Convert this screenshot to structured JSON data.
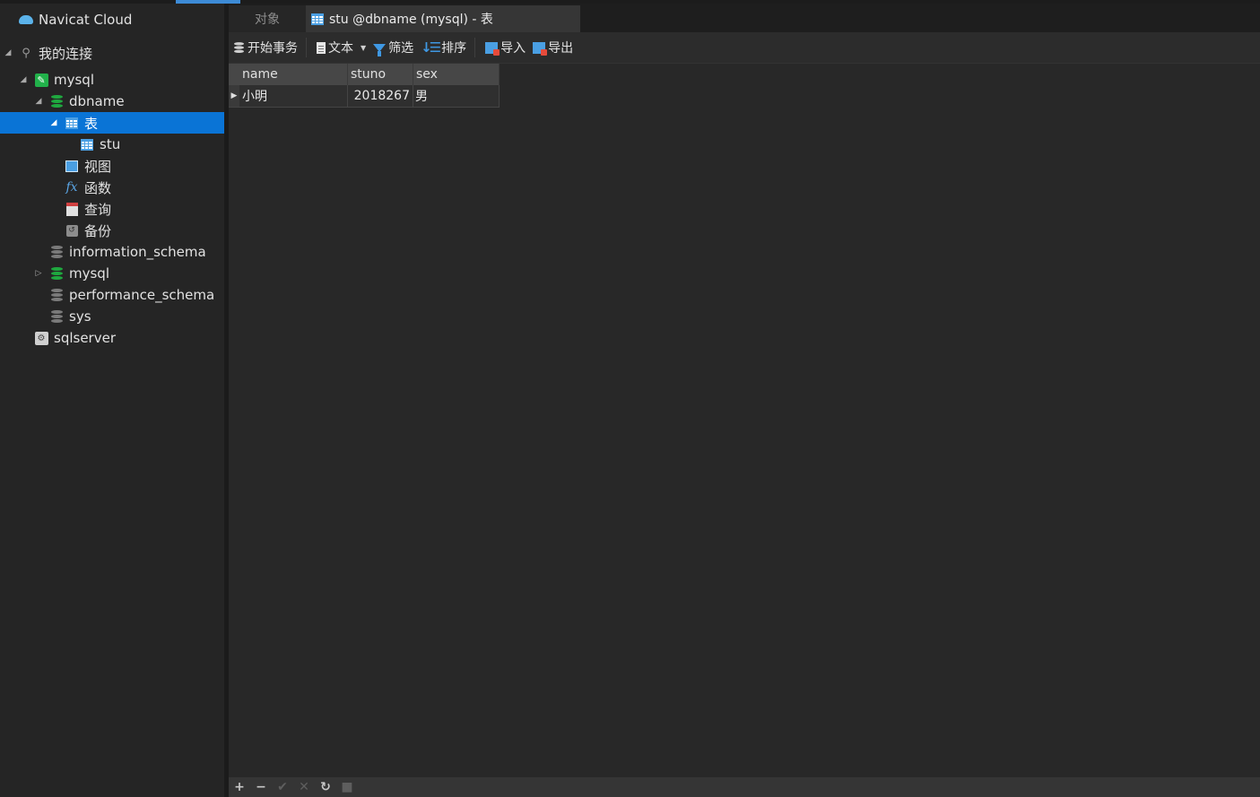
{
  "sidebar": {
    "cloud_label": "Navicat Cloud",
    "my_connections": "我的连接",
    "tree": {
      "mysql_conn": "mysql",
      "dbname": "dbname",
      "tables": "表",
      "table_stu": "stu",
      "views": "视图",
      "functions": "函数",
      "queries": "查询",
      "backups": "备份",
      "information_schema": "information_schema",
      "mysql_db": "mysql",
      "performance_schema": "performance_schema",
      "sys": "sys",
      "sqlserver_conn": "sqlserver"
    }
  },
  "tabs": {
    "objects": "对象",
    "active": "stu @dbname (mysql) - 表"
  },
  "toolbar": {
    "begin_transaction": "开始事务",
    "text": "文本",
    "filter": "筛选",
    "sort": "排序",
    "import": "导入",
    "export": "导出"
  },
  "table": {
    "columns": [
      "name",
      "stuno",
      "sex"
    ],
    "rows": [
      [
        "小明",
        "2018267",
        "男"
      ]
    ]
  },
  "bottombar": {
    "add": "+",
    "remove": "−",
    "apply": "✔",
    "discard": "✕",
    "refresh": "↻",
    "stop": "■"
  }
}
